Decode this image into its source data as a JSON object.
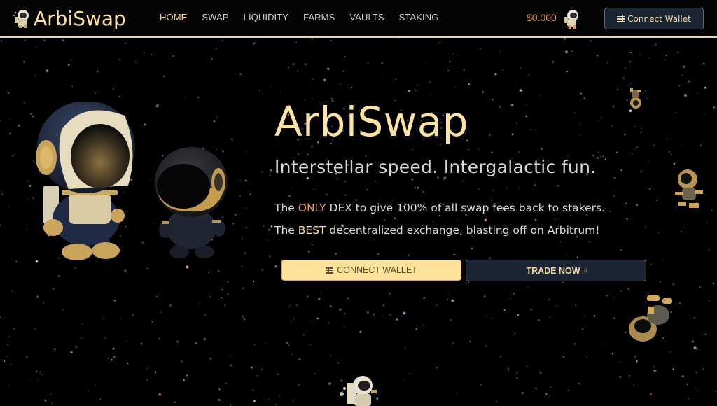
{
  "brand": {
    "name": "ArbiSwap",
    "logo_icon": "astronaut-mascot-icon",
    "accent_color": "#fde3a0",
    "highlight_orange": "#eb9a54",
    "button_dark": "#1b2432"
  },
  "nav": {
    "links": [
      {
        "label": "HOME",
        "active": true
      },
      {
        "label": "SWAP",
        "active": false
      },
      {
        "label": "LIQUIDITY",
        "active": false
      },
      {
        "label": "FARMS",
        "active": false
      },
      {
        "label": "VAULTS",
        "active": false
      },
      {
        "label": "STAKING",
        "active": false
      }
    ],
    "balance": "$0.000",
    "balance_icon": "astronaut-token-icon",
    "connect_wallet_label": "Connect Wallet",
    "connect_wallet_icon": "sliders-icon"
  },
  "hero": {
    "title": "ArbiSwap",
    "subtitle": "Interstellar speed. Intergalactic fun.",
    "line1": {
      "prefix": "The ",
      "highlight": "ONLY",
      "suffix": " DEX to give 100% of all swap fees back to stakers."
    },
    "line2": {
      "prefix": "The ",
      "highlight": "BEST",
      "suffix": " decentralized exchange, blasting off on Arbitrum!"
    },
    "cta_connect_label": "CONNECT WALLET",
    "cta_connect_icon": "sliders-icon",
    "cta_trade_label": "TRADE NOW",
    "cta_trade_icon": "swap-arrows-icon"
  },
  "illustrations": [
    "large-astronaut-figure",
    "small-astronaut-figure",
    "floating-astronaut-small",
    "floating-astronaut-right",
    "floating-astronaut-upside-down",
    "astronaut-bottom-center"
  ]
}
